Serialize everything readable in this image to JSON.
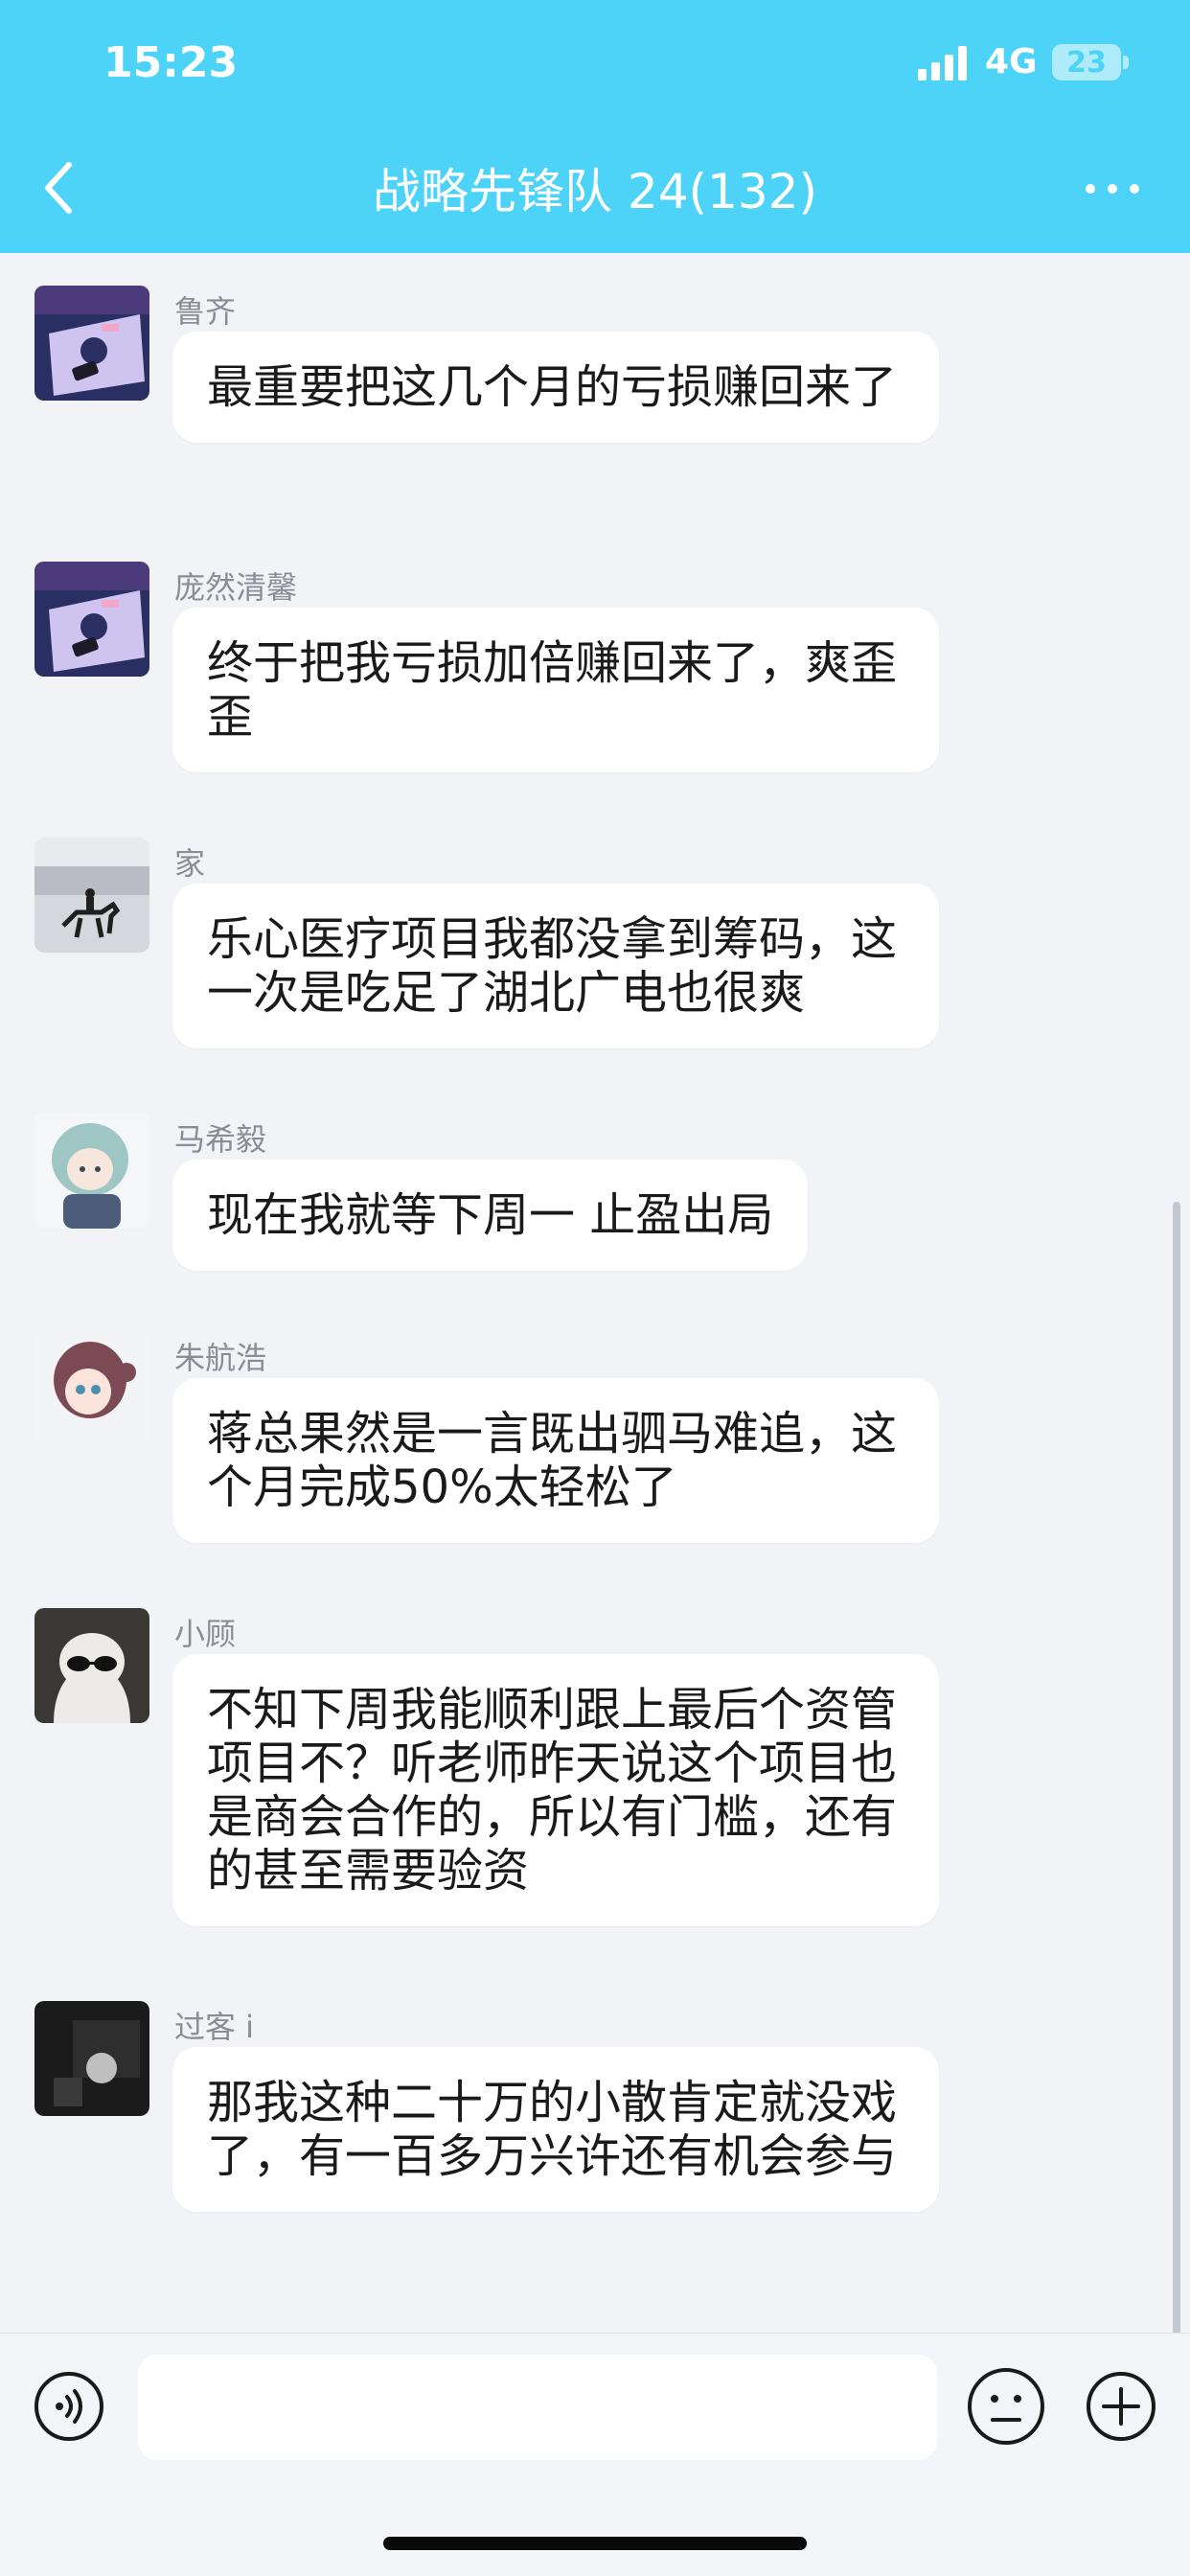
{
  "status_bar": {
    "time": "15:23",
    "network": "4G",
    "battery": "23"
  },
  "header": {
    "title": "战略先锋队 24(132)"
  },
  "messages": [
    {
      "sender": "鲁齐",
      "text": "最重要把这几个月的亏损赚回来了",
      "avatar": "anime-girl-purple-avatar"
    },
    {
      "sender": "庞然清馨",
      "text": "终于把我亏损加倍赚回来了，爽歪歪",
      "avatar": "anime-girl-purple-avatar"
    },
    {
      "sender": "家",
      "text": "乐心医疗项目我都没拿到筹码，这一次是吃足了湖北广电也很爽",
      "avatar": "horse-rider-beach-avatar"
    },
    {
      "sender": "马希毅",
      "text": "现在我就等下周一 止盈出局",
      "avatar": "anime-teal-hair-avatar"
    },
    {
      "sender": "朱航浩",
      "text": "蒋总果然是一言既出驷马难追，这个月完成50%太轻松了",
      "avatar": "anime-brown-hair-avatar"
    },
    {
      "sender": "小顾",
      "text": "不知下周我能顺利跟上最后个资管项目不？听老师昨天说这个项目也是商会合作的，所以有门槛，还有的甚至需要验资",
      "avatar": "ghost-sunglasses-avatar"
    },
    {
      "sender": "过客 i",
      "text": "那我这种二十万的小散肯定就没戏了，有一百多万兴许还有机会参与",
      "avatar": "dark-photo-avatar"
    }
  ],
  "input": {
    "placeholder": ""
  },
  "colors": {
    "header_bg": "#4cd3f7",
    "chat_bg": "#f2f3f7",
    "bubble_bg": "#ffffff"
  }
}
